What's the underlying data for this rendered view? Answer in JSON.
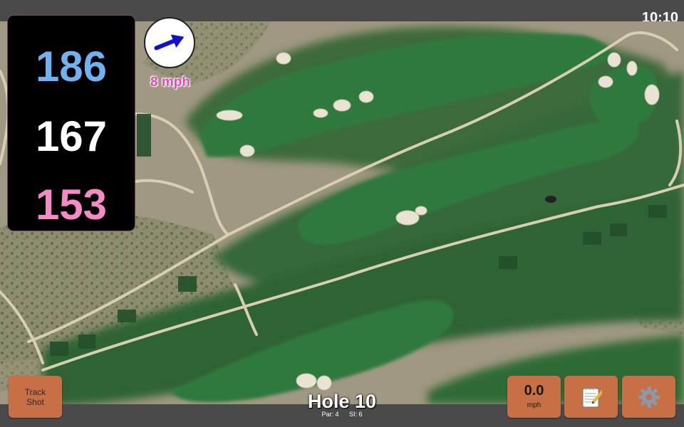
{
  "status_bar": {
    "time": "10:10"
  },
  "distances": {
    "back": "186",
    "middle": "167",
    "front": "153"
  },
  "wind_indicator": {
    "speed_label": "8 mph",
    "direction_icon": "wind-arrow-icon"
  },
  "hole": {
    "title": "Hole 10",
    "par_label": "Par: 4",
    "si_label": "SI: 6"
  },
  "buttons": {
    "track_shot_label": "Track Shot",
    "wind_value": "0.0",
    "wind_unit": "mph",
    "notes_icon": "notepad-icon",
    "settings_icon": "gear-icon"
  },
  "colors": {
    "back_distance": "#6fb2ef",
    "middle_distance": "#ffffff",
    "front_distance": "#f58bc6",
    "button_bg": "#c76f45",
    "bar_bg": "#4a4a4a",
    "wind_speed_text": "#e24ab0",
    "wind_arrow": "#1010d0"
  }
}
